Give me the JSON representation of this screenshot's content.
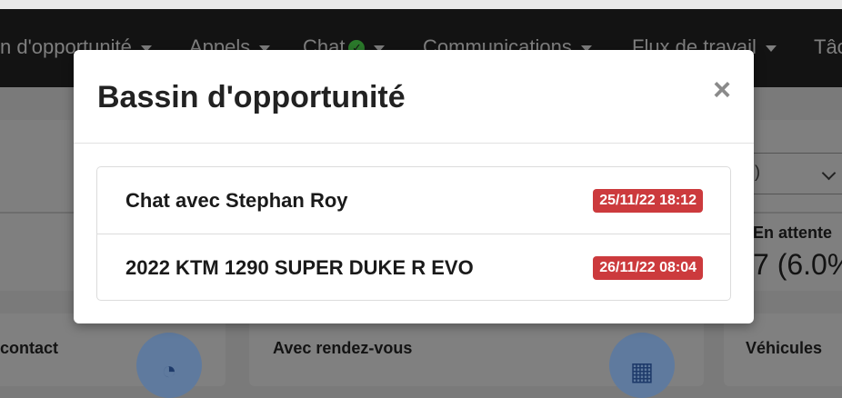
{
  "background": {
    "nav": [
      {
        "label": "n d'opportunité"
      },
      {
        "label": "Appels"
      },
      {
        "label": "Chat"
      },
      {
        "label": "Communications"
      },
      {
        "label": "Flux de travail"
      },
      {
        "label": "Tâc"
      }
    ],
    "select_value": "U)",
    "stat": {
      "label": "En attente",
      "value": "7 (6.0%"
    },
    "cards": [
      {
        "label": "contact"
      },
      {
        "label": "Avec rendez-vous"
      },
      {
        "label": "Véhicules"
      }
    ]
  },
  "modal": {
    "title": "Bassin d'opportunité",
    "close_symbol": "×",
    "items": [
      {
        "label": "Chat avec Stephan Roy",
        "timestamp": "25/11/22 18:12"
      },
      {
        "label": "2022 KTM 1290 SUPER DUKE R EVO",
        "timestamp": "26/11/22 08:04"
      }
    ]
  },
  "colors": {
    "badge": "#cc3a3d",
    "overlay_navbar": "#131313",
    "accent_icon": "#5f7a9e"
  }
}
